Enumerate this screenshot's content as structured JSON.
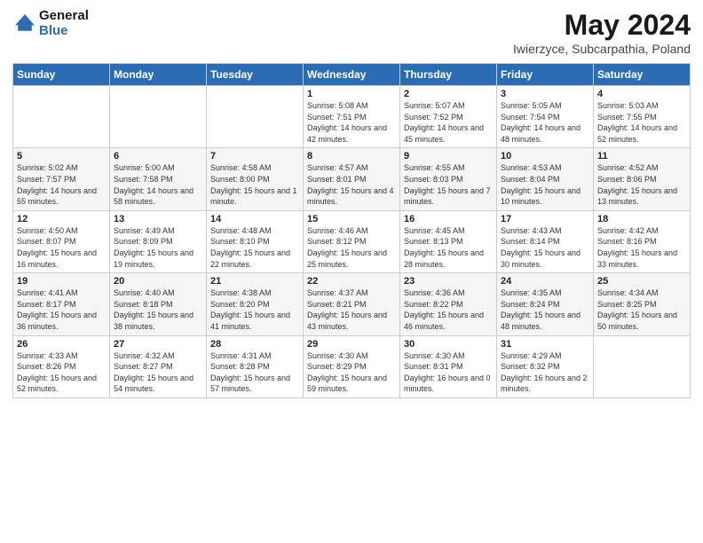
{
  "header": {
    "logo_line1": "General",
    "logo_line2": "Blue",
    "main_title": "May 2024",
    "subtitle": "Iwierzyce, Subcarpathia, Poland"
  },
  "days_of_week": [
    "Sunday",
    "Monday",
    "Tuesday",
    "Wednesday",
    "Thursday",
    "Friday",
    "Saturday"
  ],
  "weeks": [
    [
      {
        "day": "",
        "sunrise": "",
        "sunset": "",
        "daylight": ""
      },
      {
        "day": "",
        "sunrise": "",
        "sunset": "",
        "daylight": ""
      },
      {
        "day": "",
        "sunrise": "",
        "sunset": "",
        "daylight": ""
      },
      {
        "day": "1",
        "sunrise": "Sunrise: 5:08 AM",
        "sunset": "Sunset: 7:51 PM",
        "daylight": "Daylight: 14 hours and 42 minutes."
      },
      {
        "day": "2",
        "sunrise": "Sunrise: 5:07 AM",
        "sunset": "Sunset: 7:52 PM",
        "daylight": "Daylight: 14 hours and 45 minutes."
      },
      {
        "day": "3",
        "sunrise": "Sunrise: 5:05 AM",
        "sunset": "Sunset: 7:54 PM",
        "daylight": "Daylight: 14 hours and 48 minutes."
      },
      {
        "day": "4",
        "sunrise": "Sunrise: 5:03 AM",
        "sunset": "Sunset: 7:55 PM",
        "daylight": "Daylight: 14 hours and 52 minutes."
      }
    ],
    [
      {
        "day": "5",
        "sunrise": "Sunrise: 5:02 AM",
        "sunset": "Sunset: 7:57 PM",
        "daylight": "Daylight: 14 hours and 55 minutes."
      },
      {
        "day": "6",
        "sunrise": "Sunrise: 5:00 AM",
        "sunset": "Sunset: 7:58 PM",
        "daylight": "Daylight: 14 hours and 58 minutes."
      },
      {
        "day": "7",
        "sunrise": "Sunrise: 4:58 AM",
        "sunset": "Sunset: 8:00 PM",
        "daylight": "Daylight: 15 hours and 1 minute."
      },
      {
        "day": "8",
        "sunrise": "Sunrise: 4:57 AM",
        "sunset": "Sunset: 8:01 PM",
        "daylight": "Daylight: 15 hours and 4 minutes."
      },
      {
        "day": "9",
        "sunrise": "Sunrise: 4:55 AM",
        "sunset": "Sunset: 8:03 PM",
        "daylight": "Daylight: 15 hours and 7 minutes."
      },
      {
        "day": "10",
        "sunrise": "Sunrise: 4:53 AM",
        "sunset": "Sunset: 8:04 PM",
        "daylight": "Daylight: 15 hours and 10 minutes."
      },
      {
        "day": "11",
        "sunrise": "Sunrise: 4:52 AM",
        "sunset": "Sunset: 8:06 PM",
        "daylight": "Daylight: 15 hours and 13 minutes."
      }
    ],
    [
      {
        "day": "12",
        "sunrise": "Sunrise: 4:50 AM",
        "sunset": "Sunset: 8:07 PM",
        "daylight": "Daylight: 15 hours and 16 minutes."
      },
      {
        "day": "13",
        "sunrise": "Sunrise: 4:49 AM",
        "sunset": "Sunset: 8:09 PM",
        "daylight": "Daylight: 15 hours and 19 minutes."
      },
      {
        "day": "14",
        "sunrise": "Sunrise: 4:48 AM",
        "sunset": "Sunset: 8:10 PM",
        "daylight": "Daylight: 15 hours and 22 minutes."
      },
      {
        "day": "15",
        "sunrise": "Sunrise: 4:46 AM",
        "sunset": "Sunset: 8:12 PM",
        "daylight": "Daylight: 15 hours and 25 minutes."
      },
      {
        "day": "16",
        "sunrise": "Sunrise: 4:45 AM",
        "sunset": "Sunset: 8:13 PM",
        "daylight": "Daylight: 15 hours and 28 minutes."
      },
      {
        "day": "17",
        "sunrise": "Sunrise: 4:43 AM",
        "sunset": "Sunset: 8:14 PM",
        "daylight": "Daylight: 15 hours and 30 minutes."
      },
      {
        "day": "18",
        "sunrise": "Sunrise: 4:42 AM",
        "sunset": "Sunset: 8:16 PM",
        "daylight": "Daylight: 15 hours and 33 minutes."
      }
    ],
    [
      {
        "day": "19",
        "sunrise": "Sunrise: 4:41 AM",
        "sunset": "Sunset: 8:17 PM",
        "daylight": "Daylight: 15 hours and 36 minutes."
      },
      {
        "day": "20",
        "sunrise": "Sunrise: 4:40 AM",
        "sunset": "Sunset: 8:18 PM",
        "daylight": "Daylight: 15 hours and 38 minutes."
      },
      {
        "day": "21",
        "sunrise": "Sunrise: 4:38 AM",
        "sunset": "Sunset: 8:20 PM",
        "daylight": "Daylight: 15 hours and 41 minutes."
      },
      {
        "day": "22",
        "sunrise": "Sunrise: 4:37 AM",
        "sunset": "Sunset: 8:21 PM",
        "daylight": "Daylight: 15 hours and 43 minutes."
      },
      {
        "day": "23",
        "sunrise": "Sunrise: 4:36 AM",
        "sunset": "Sunset: 8:22 PM",
        "daylight": "Daylight: 15 hours and 46 minutes."
      },
      {
        "day": "24",
        "sunrise": "Sunrise: 4:35 AM",
        "sunset": "Sunset: 8:24 PM",
        "daylight": "Daylight: 15 hours and 48 minutes."
      },
      {
        "day": "25",
        "sunrise": "Sunrise: 4:34 AM",
        "sunset": "Sunset: 8:25 PM",
        "daylight": "Daylight: 15 hours and 50 minutes."
      }
    ],
    [
      {
        "day": "26",
        "sunrise": "Sunrise: 4:33 AM",
        "sunset": "Sunset: 8:26 PM",
        "daylight": "Daylight: 15 hours and 52 minutes."
      },
      {
        "day": "27",
        "sunrise": "Sunrise: 4:32 AM",
        "sunset": "Sunset: 8:27 PM",
        "daylight": "Daylight: 15 hours and 54 minutes."
      },
      {
        "day": "28",
        "sunrise": "Sunrise: 4:31 AM",
        "sunset": "Sunset: 8:28 PM",
        "daylight": "Daylight: 15 hours and 57 minutes."
      },
      {
        "day": "29",
        "sunrise": "Sunrise: 4:30 AM",
        "sunset": "Sunset: 8:29 PM",
        "daylight": "Daylight: 15 hours and 59 minutes."
      },
      {
        "day": "30",
        "sunrise": "Sunrise: 4:30 AM",
        "sunset": "Sunset: 8:31 PM",
        "daylight": "Daylight: 16 hours and 0 minutes."
      },
      {
        "day": "31",
        "sunrise": "Sunrise: 4:29 AM",
        "sunset": "Sunset: 8:32 PM",
        "daylight": "Daylight: 16 hours and 2 minutes."
      },
      {
        "day": "",
        "sunrise": "",
        "sunset": "",
        "daylight": ""
      }
    ]
  ]
}
